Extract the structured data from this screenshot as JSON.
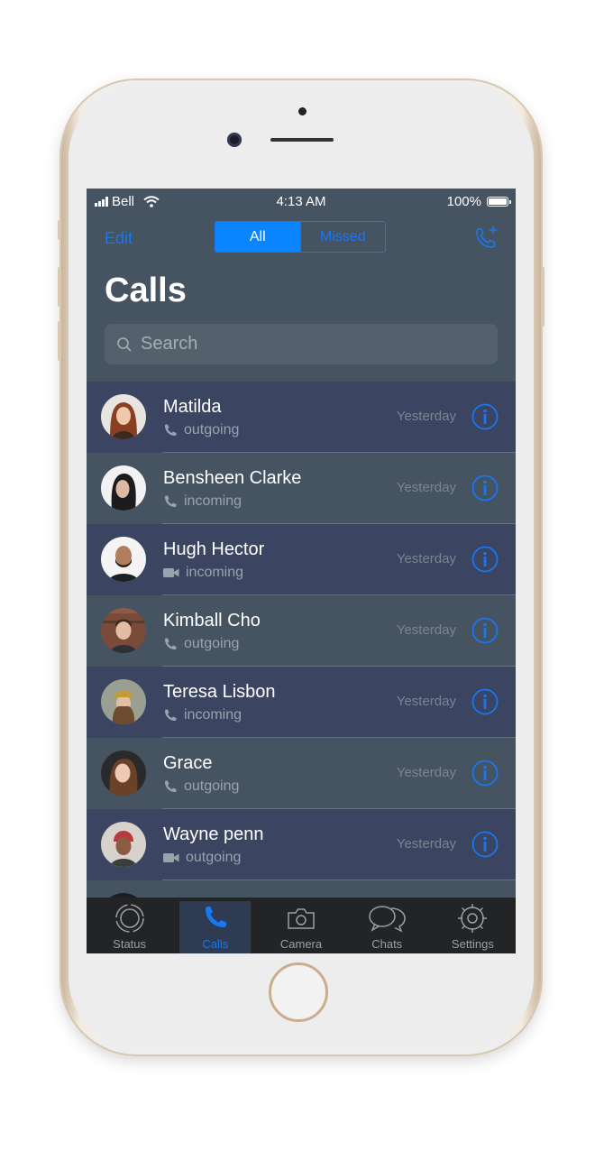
{
  "status_bar": {
    "carrier": "Bell",
    "time": "4:13 AM",
    "battery": "100%"
  },
  "header": {
    "edit": "Edit",
    "segments": [
      "All",
      "Missed"
    ],
    "title": "Calls"
  },
  "search": {
    "placeholder": "Search"
  },
  "calls": [
    {
      "name": "Matilda",
      "type": "outgoing",
      "kind": "phone",
      "time": "Yesterday"
    },
    {
      "name": "Bensheen Clarke",
      "type": "incoming",
      "kind": "phone",
      "time": "Yesterday"
    },
    {
      "name": "Hugh Hector",
      "type": "incoming",
      "kind": "video",
      "time": "Yesterday"
    },
    {
      "name": "Kimball Cho",
      "type": "outgoing",
      "kind": "phone",
      "time": "Yesterday"
    },
    {
      "name": "Teresa Lisbon",
      "type": "incoming",
      "kind": "phone",
      "time": "Yesterday"
    },
    {
      "name": "Grace",
      "type": "outgoing",
      "kind": "phone",
      "time": "Yesterday"
    },
    {
      "name": "Wayne penn",
      "type": "outgoing",
      "kind": "video",
      "time": "Yesterday"
    }
  ],
  "tabs": [
    "Status",
    "Calls",
    "Camera",
    "Chats",
    "Settings"
  ],
  "colors": {
    "accent": "#1877f2",
    "row_dark": "#3b4461",
    "row_light": "#465361",
    "tabbar": "#232426"
  }
}
